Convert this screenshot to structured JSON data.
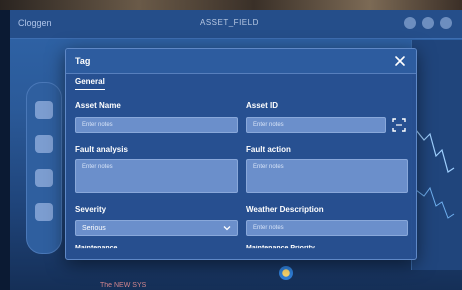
{
  "background": {
    "header_title": "ASSET_FIELD",
    "logo_text": "Cloggen",
    "bottom_text": "The NEW SYS"
  },
  "dialog": {
    "title": "Tag",
    "active_tab": "General",
    "fields": {
      "asset_name": {
        "label": "Asset Name",
        "placeholder": "Enter notes"
      },
      "asset_id": {
        "label": "Asset ID",
        "placeholder": "Enter notes"
      },
      "fault_analysis": {
        "label": "Fault analysis",
        "placeholder": "Enter notes"
      },
      "fault_action": {
        "label": "Fault action",
        "placeholder": "Enter notes"
      },
      "severity": {
        "label": "Severity",
        "value": "Serious"
      },
      "weather_description": {
        "label": "Weather Description",
        "placeholder": "Enter notes"
      },
      "maintenance": {
        "label": "Maintenance"
      },
      "maintenance_priority": {
        "label": "Maintenance Priority"
      }
    }
  },
  "colors": {
    "dialog_bg": "#2d5c9f",
    "field_bg": "#6b8fcb",
    "app_bg": "#2f64a8"
  }
}
